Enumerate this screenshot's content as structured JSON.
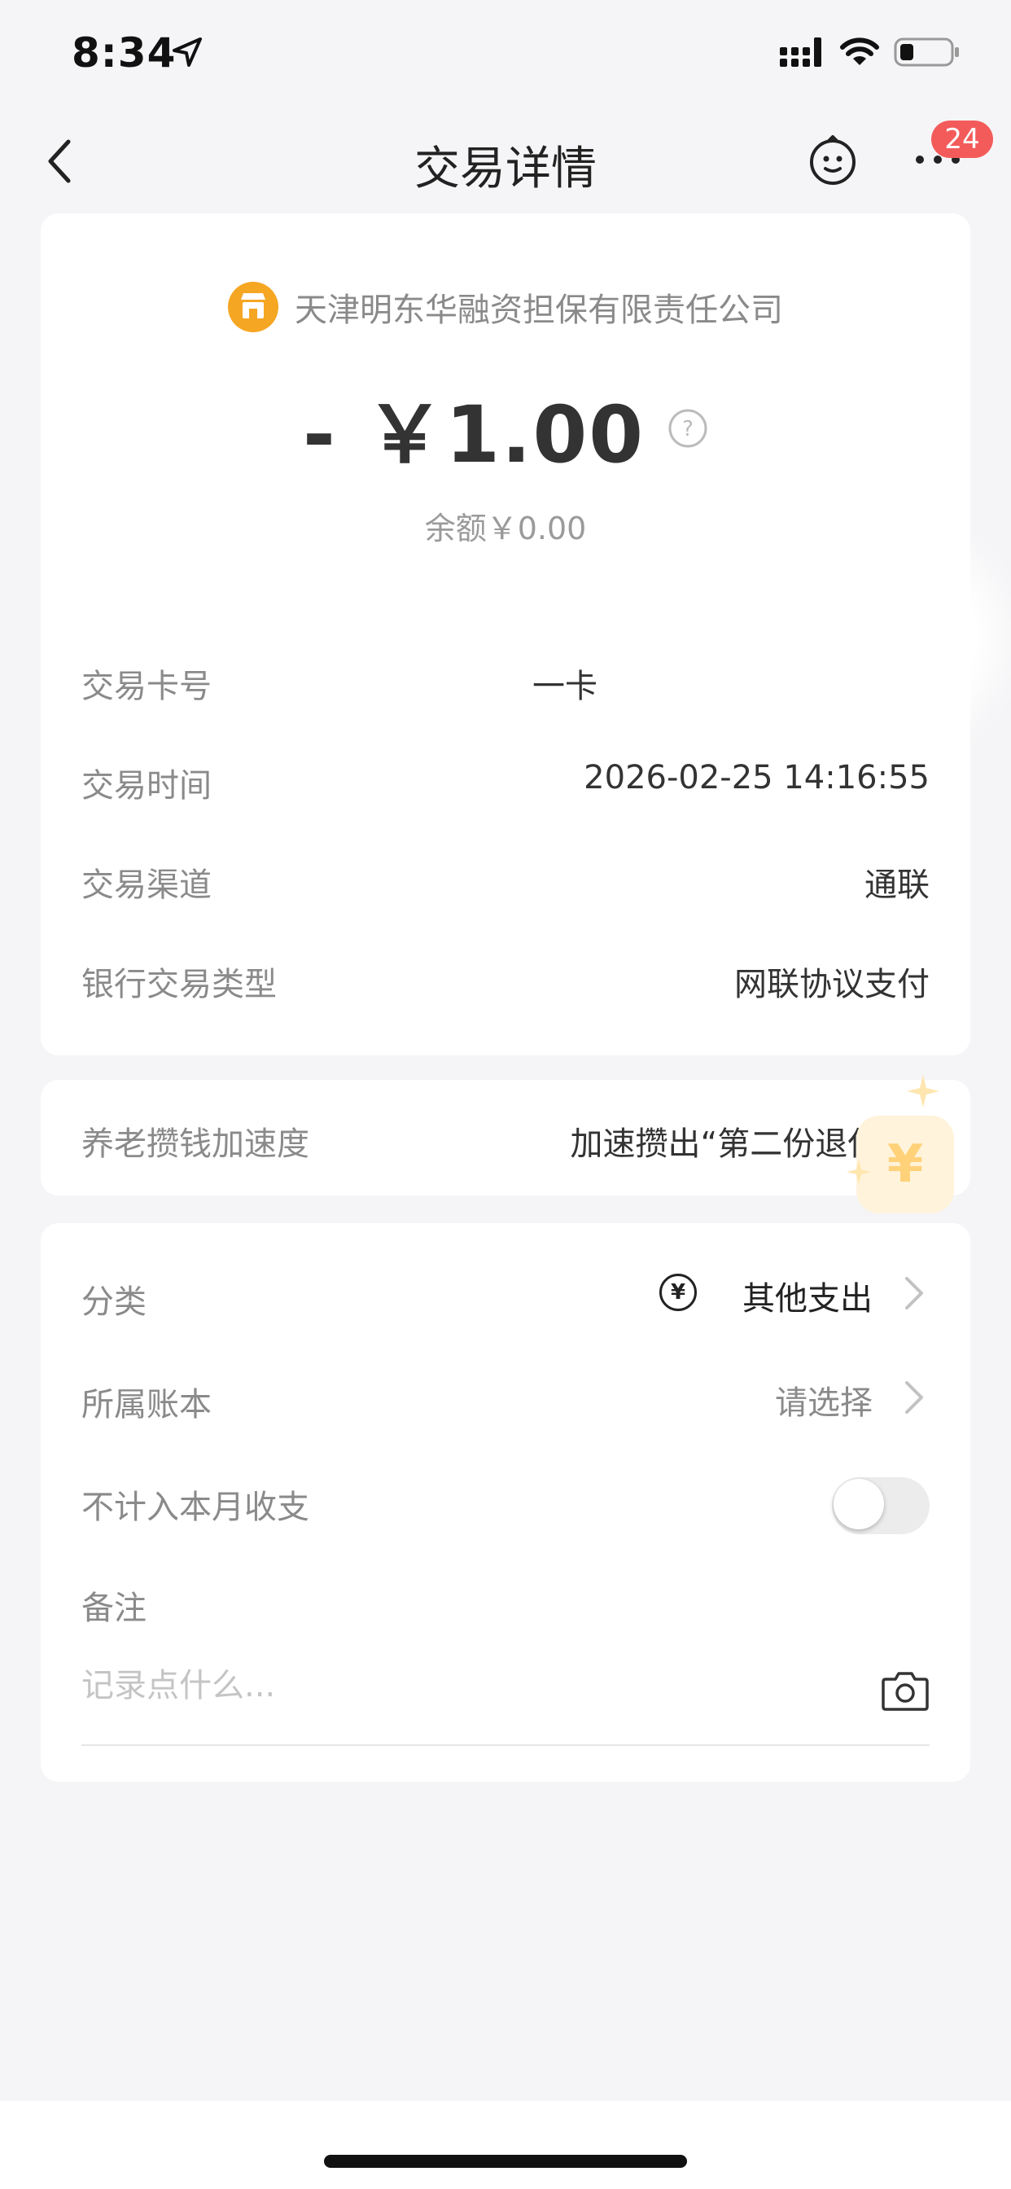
{
  "status_bar": {
    "time": "8:34"
  },
  "nav": {
    "title": "交易详情",
    "badge_count": "24"
  },
  "summary": {
    "merchant": "天津明东华融资担保有限责任公司",
    "amount": "- ￥1.00",
    "balance": "余额￥0.00"
  },
  "details": [
    {
      "label": "交易卡号",
      "value": "一卡"
    },
    {
      "label": "交易时间",
      "value": "2026-02-25 14:16:55"
    },
    {
      "label": "交易渠道",
      "value": "通联"
    },
    {
      "label": "银行交易类型",
      "value": "网联协议支付"
    }
  ],
  "pension": {
    "label": "养老攒钱加速度",
    "value": "加速攒出“第二份退休金”"
  },
  "settings": {
    "category_label": "分类",
    "category_value": "其他支出",
    "ledger_label": "所属账本",
    "ledger_value": "请选择",
    "exclude_label": "不计入本月收支",
    "exclude_enabled": false,
    "note_label": "备注",
    "note_placeholder": "记录点什么..."
  },
  "icons": {
    "back": "chevron-left-icon",
    "assistant": "robot-face-icon",
    "more": "more-dots-icon",
    "merchant": "store-icon",
    "help": "question-circle-icon",
    "category": "yuan-circle-icon",
    "camera": "camera-icon"
  },
  "colors": {
    "background": "#f5f5f7",
    "badge": "#f35b5b",
    "merchant_icon": "#f5a623",
    "toggle_off": "#ececec"
  }
}
